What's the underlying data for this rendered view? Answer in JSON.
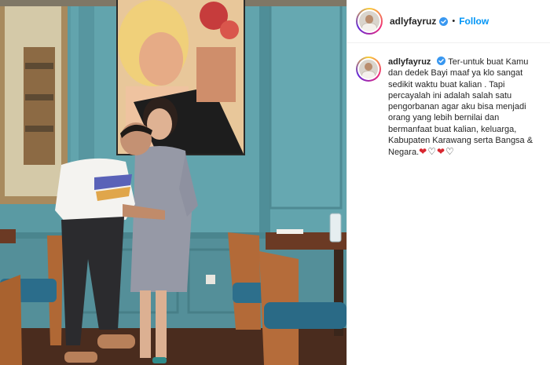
{
  "post": {
    "username": "adlyfayruz",
    "follow_label": "Follow",
    "dot": "•",
    "caption": "Ter-untuk buat Kamu dan dedek Bayi maaf ya klo sangat sedikit waktu buat kalian . Tapi percayalah ini adalah salah satu pengorbanan agar aku bisa menjadi orang yang lebih bernilai dan bermanfaat buat kalian, keluarga, Kabupaten Karawang serta Bangsa & Negara.",
    "hearts": [
      "red",
      "white",
      "red",
      "white"
    ],
    "heart_glyphs": {
      "red": "❤",
      "white": "♡"
    }
  },
  "icons": {
    "verified": "verified-badge-icon",
    "avatar": "avatar-icon"
  },
  "colors": {
    "follow": "#0095f6",
    "verified": "#3897f0",
    "wall": "#5f9ea6",
    "heart_red": "#d8262f"
  }
}
